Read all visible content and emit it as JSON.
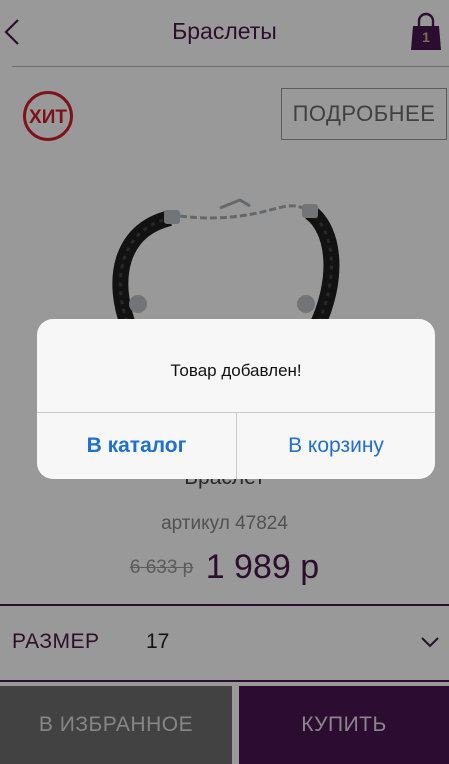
{
  "header": {
    "title": "Браслеты",
    "cart_count": "1"
  },
  "badges": {
    "hit_label": "ХИТ",
    "more_button": "ПОДРОБНЕЕ"
  },
  "product": {
    "name": "Браслет",
    "article": "артикул 47824",
    "old_price": "6 633 р",
    "new_price": "1 989 р"
  },
  "size": {
    "label": "РАЗМЕР",
    "value": "17"
  },
  "actions": {
    "favorite": "В ИЗБРАННОЕ",
    "buy": "КУПИТЬ"
  },
  "dialog": {
    "message": "Товар добавлен!",
    "catalog_button": "В каталог",
    "cart_button": "В корзину"
  },
  "colors": {
    "brand": "#4a1452",
    "accent_red": "#d0202a",
    "link_blue": "#1f6fd6"
  }
}
